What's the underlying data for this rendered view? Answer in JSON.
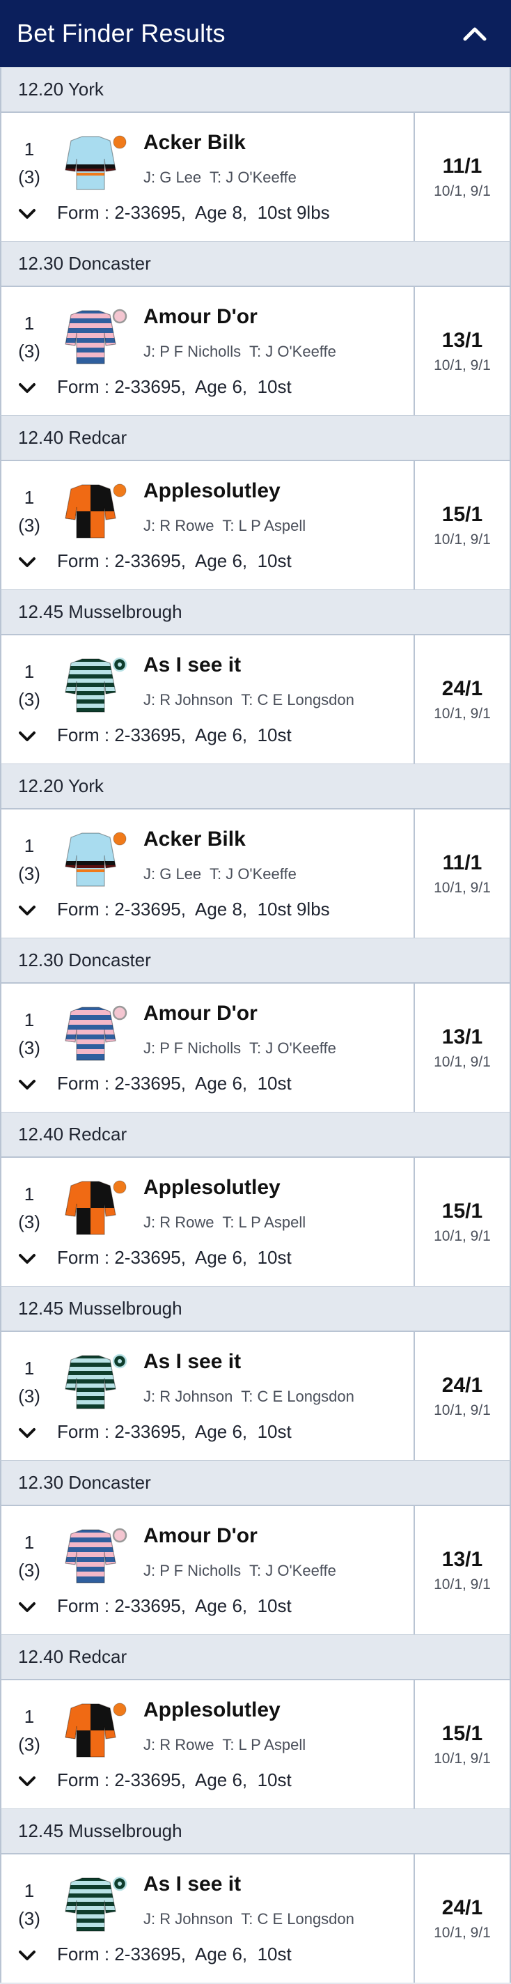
{
  "header": {
    "title": "Bet Finder Results",
    "collapse_icon": "chevron-up-icon",
    "bg_color": "#0b1f5c"
  },
  "races": [
    {
      "race": "12.20 York",
      "position": "1",
      "draw": "(3)",
      "horse": "Acker Bilk",
      "jockey": "J: G Lee",
      "trainer": "T: J O'Keeffe",
      "form": "Form : 2-33695,  Age 8,  10st 9lbs",
      "odds": "11/1",
      "prev_odds": "10/1, 9/1",
      "silks": "light-blue-black-orange-hoops",
      "expand_icon": "chevron-down-icon"
    },
    {
      "race": "12.30 Doncaster",
      "position": "1",
      "draw": "(3)",
      "horse": "Amour D'or",
      "jockey": "J: P F Nicholls",
      "trainer": "T: J O'Keeffe",
      "form": "Form : 2-33695,  Age 6,  10st",
      "odds": "13/1",
      "prev_odds": "10/1, 9/1",
      "silks": "blue-pink-hoops",
      "expand_icon": "chevron-down-icon"
    },
    {
      "race": "12.40 Redcar",
      "position": "1",
      "draw": "(3)",
      "horse": "Applesolutley",
      "jockey": "J: R Rowe",
      "trainer": "T: L P Aspell",
      "form": "Form : 2-33695,  Age 6,  10st",
      "odds": "15/1",
      "prev_odds": "10/1, 9/1",
      "silks": "orange-black-quartered",
      "expand_icon": "chevron-down-icon"
    },
    {
      "race": "12.45 Musselbrough",
      "position": "1",
      "draw": "(3)",
      "horse": "As I see it",
      "jockey": "J: R Johnson",
      "trainer": "T: C E Longsdon",
      "form": "Form : 2-33695,  Age 6,  10st",
      "odds": "24/1",
      "prev_odds": "10/1, 9/1",
      "silks": "dark-green-light-blue-hoops",
      "expand_icon": "chevron-down-icon"
    },
    {
      "race": "12.20 York",
      "position": "1",
      "draw": "(3)",
      "horse": "Acker Bilk",
      "jockey": "J: G Lee",
      "trainer": "T: J O'Keeffe",
      "form": "Form : 2-33695,  Age 8,  10st 9lbs",
      "odds": "11/1",
      "prev_odds": "10/1, 9/1",
      "silks": "light-blue-black-orange-hoops",
      "expand_icon": "chevron-down-icon"
    },
    {
      "race": "12.30 Doncaster",
      "position": "1",
      "draw": "(3)",
      "horse": "Amour D'or",
      "jockey": "J: P F Nicholls",
      "trainer": "T: J O'Keeffe",
      "form": "Form : 2-33695,  Age 6,  10st",
      "odds": "13/1",
      "prev_odds": "10/1, 9/1",
      "silks": "blue-pink-hoops",
      "expand_icon": "chevron-down-icon"
    },
    {
      "race": "12.40 Redcar",
      "position": "1",
      "draw": "(3)",
      "horse": "Applesolutley",
      "jockey": "J: R Rowe",
      "trainer": "T: L P Aspell",
      "form": "Form : 2-33695,  Age 6,  10st",
      "odds": "15/1",
      "prev_odds": "10/1, 9/1",
      "silks": "orange-black-quartered",
      "expand_icon": "chevron-down-icon"
    },
    {
      "race": "12.45 Musselbrough",
      "position": "1",
      "draw": "(3)",
      "horse": "As I see it",
      "jockey": "J: R Johnson",
      "trainer": "T: C E Longsdon",
      "form": "Form : 2-33695,  Age 6,  10st",
      "odds": "24/1",
      "prev_odds": "10/1, 9/1",
      "silks": "dark-green-light-blue-hoops",
      "expand_icon": "chevron-down-icon"
    },
    {
      "race": "12.30 Doncaster",
      "position": "1",
      "draw": "(3)",
      "horse": "Amour D'or",
      "jockey": "J: P F Nicholls",
      "trainer": "T: J O'Keeffe",
      "form": "Form : 2-33695,  Age 6,  10st",
      "odds": "13/1",
      "prev_odds": "10/1, 9/1",
      "silks": "blue-pink-hoops",
      "expand_icon": "chevron-down-icon"
    },
    {
      "race": "12.40 Redcar",
      "position": "1",
      "draw": "(3)",
      "horse": "Applesolutley",
      "jockey": "J: R Rowe",
      "trainer": "T: L P Aspell",
      "form": "Form : 2-33695,  Age 6,  10st",
      "odds": "15/1",
      "prev_odds": "10/1, 9/1",
      "silks": "orange-black-quartered",
      "expand_icon": "chevron-down-icon"
    },
    {
      "race": "12.45 Musselbrough",
      "position": "1",
      "draw": "(3)",
      "horse": "As I see it",
      "jockey": "J: R Johnson",
      "trainer": "T: C E Longsdon",
      "form": "Form : 2-33695,  Age 6,  10st",
      "odds": "24/1",
      "prev_odds": "10/1, 9/1",
      "silks": "dark-green-light-blue-hoops",
      "expand_icon": "chevron-down-icon"
    }
  ]
}
